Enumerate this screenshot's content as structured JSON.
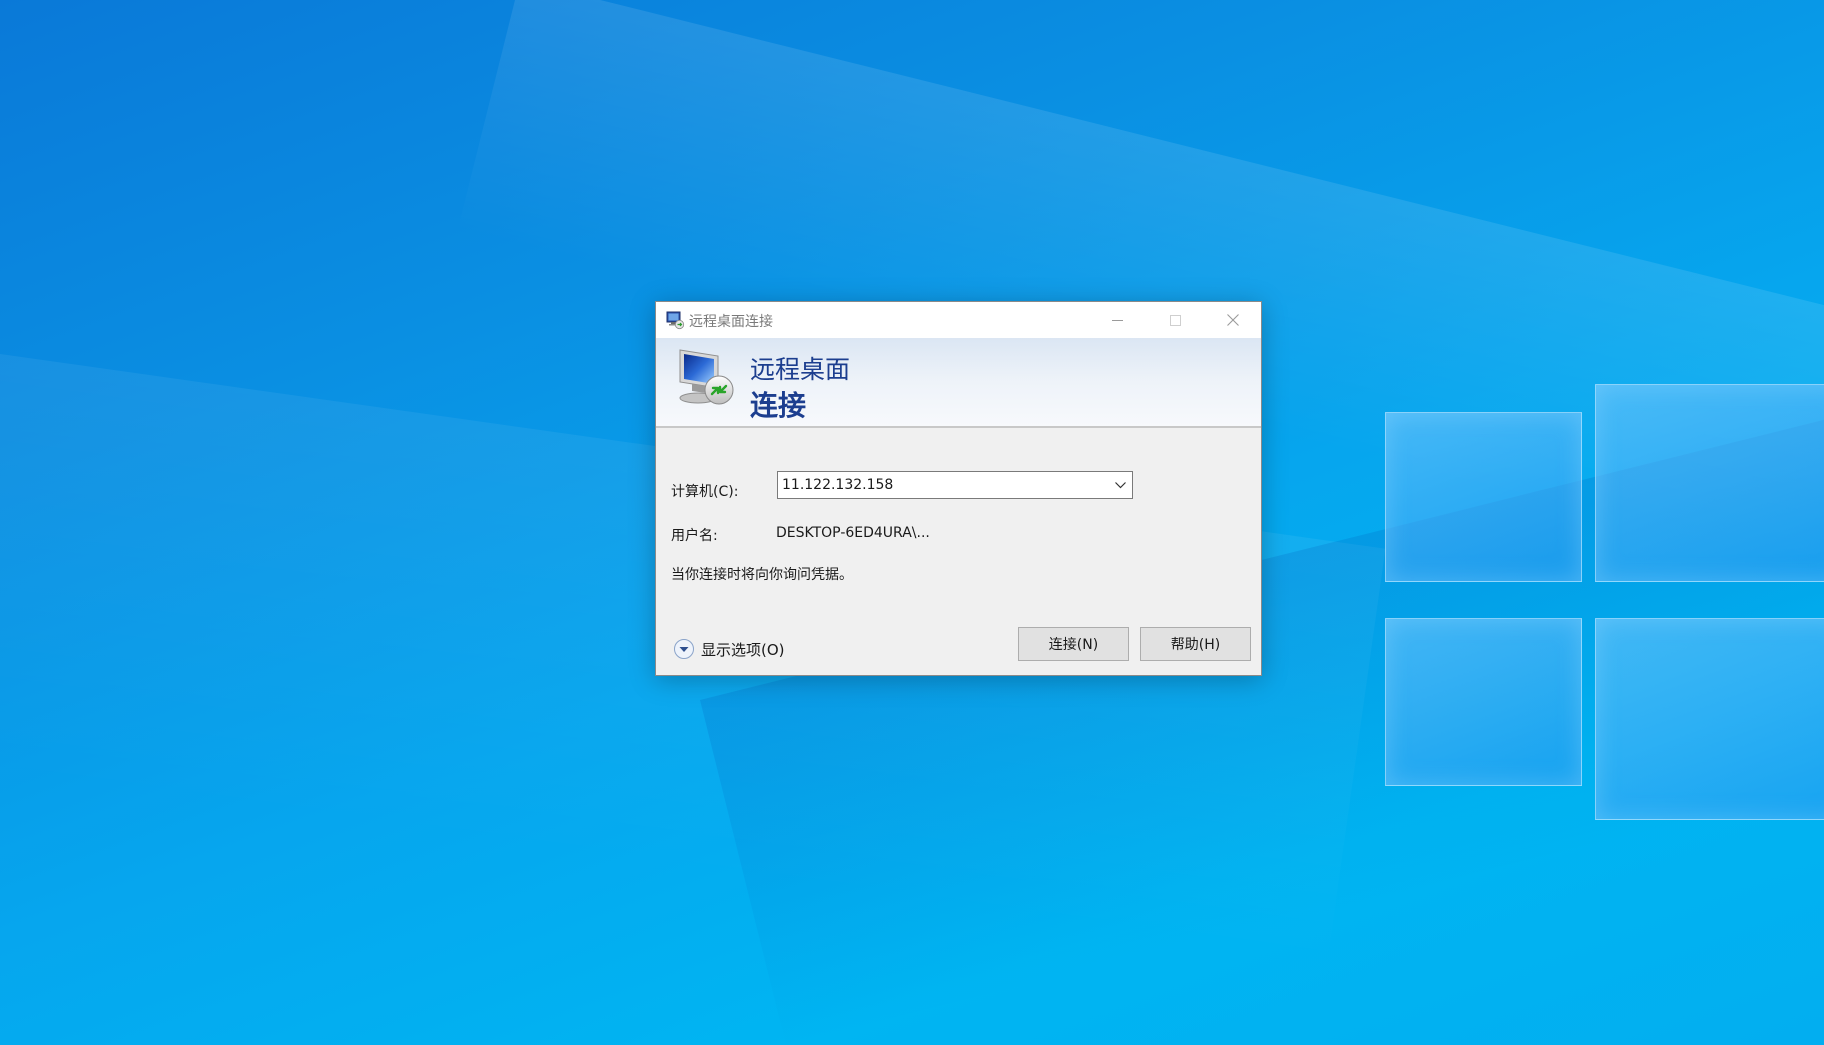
{
  "window": {
    "title": "远程桌面连接",
    "icons": {
      "title": "remote-desktop-icon",
      "minimize": "minimize-icon",
      "maximize": "maximize-icon",
      "close": "close-icon"
    }
  },
  "banner": {
    "line1": "远程桌面",
    "line2": "连接",
    "icon": "remote-desktop-monitor-icon",
    "color": "#1c3e8f"
  },
  "form": {
    "computer_label": "计算机(C):",
    "computer_value": "11.122.132.158",
    "username_label": "用户名:",
    "username_value": "DESKTOP-6ED4URA\\...",
    "credential_note": "当你连接时将向你询问凭据。"
  },
  "footer": {
    "show_options": "显示选项(O)",
    "connect_button": "连接(N)",
    "help_button": "帮助(H)"
  },
  "desktop": {
    "wallpaper": "windows-10-hero-wallpaper",
    "accent": "#0a8fe2"
  }
}
